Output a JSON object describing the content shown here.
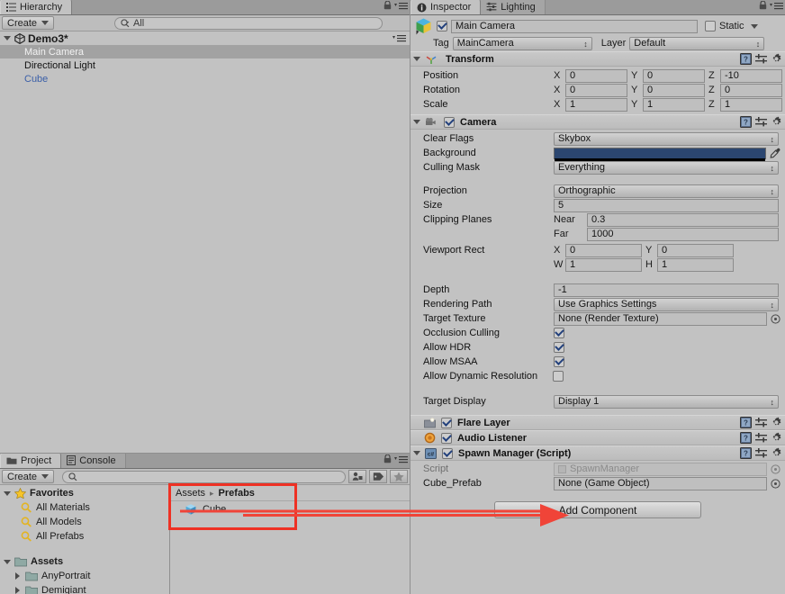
{
  "app": "unity-editor",
  "hierarchy": {
    "tabs": [
      {
        "label": "Hierarchy",
        "icon": "hierarchy-icon",
        "active": true
      }
    ],
    "create_label": "Create",
    "search_value": "All",
    "search_placeholder": "",
    "scene": {
      "name": "Demo3*",
      "icon": "unity-scene-icon"
    },
    "items": [
      {
        "label": "Main Camera",
        "selected": true,
        "prefab": false
      },
      {
        "label": "Directional Light",
        "selected": false,
        "prefab": false
      },
      {
        "label": "Cube",
        "selected": false,
        "prefab": true
      }
    ]
  },
  "project": {
    "tabs": [
      {
        "label": "Project",
        "icon": "folder-icon",
        "active": true
      },
      {
        "label": "Console",
        "icon": "console-icon",
        "active": false
      }
    ],
    "create_label": "Create",
    "search_value": "",
    "search_placeholder": "",
    "filter_icons": [
      "filter-by-type-icon",
      "filter-by-label-icon",
      "favorite-star-icon"
    ],
    "tree": [
      {
        "label": "Favorites",
        "icon": "star-icon",
        "depth": 0,
        "expanded": true,
        "bold": true
      },
      {
        "label": "All Materials",
        "icon": "search-icon",
        "depth": 1,
        "bold": false
      },
      {
        "label": "All Models",
        "icon": "search-icon",
        "depth": 1,
        "bold": false
      },
      {
        "label": "All Prefabs",
        "icon": "search-icon",
        "depth": 1,
        "bold": false
      },
      {
        "label": "Assets",
        "icon": "folder-icon",
        "depth": 0,
        "expanded": true,
        "bold": true
      },
      {
        "label": "AnyPortrait",
        "icon": "folder-icon",
        "depth": 1,
        "collapsed": true,
        "bold": false
      },
      {
        "label": "Demigiant",
        "icon": "folder-icon",
        "depth": 1,
        "collapsed": true,
        "bold": false
      }
    ],
    "breadcrumb": {
      "root": "Assets",
      "current": "Prefabs",
      "separator": "▸"
    },
    "assets": [
      {
        "label": "Cube",
        "icon": "prefab-cube-icon"
      }
    ]
  },
  "inspector": {
    "tabs": [
      {
        "label": "Inspector",
        "icon": "info-icon",
        "active": true
      },
      {
        "label": "Lighting",
        "icon": "lighting-icon",
        "active": false
      }
    ],
    "object": {
      "icon": "gameobject-cube-icon",
      "enabled": true,
      "name": "Main Camera",
      "static_label": "Static",
      "static_checked": false,
      "tag_label": "Tag",
      "tag_value": "MainCamera",
      "layer_label": "Layer",
      "layer_value": "Default"
    },
    "components": [
      {
        "name": "Transform",
        "icon": "transform-axis-icon",
        "expanded": true,
        "has_checkbox": false,
        "rows": [
          {
            "label": "Position",
            "type": "vector3",
            "x": "0",
            "y": "0",
            "z": "-10"
          },
          {
            "label": "Rotation",
            "type": "vector3",
            "x": "0",
            "y": "0",
            "z": "0"
          },
          {
            "label": "Scale",
            "type": "vector3",
            "x": "1",
            "y": "1",
            "z": "1"
          }
        ]
      },
      {
        "name": "Camera",
        "icon": "camera-icon",
        "expanded": true,
        "has_checkbox": true,
        "checked": true,
        "rows": [
          {
            "label": "Clear Flags",
            "type": "popup",
            "value": "Skybox"
          },
          {
            "label": "Background",
            "type": "color",
            "value": "#2b4670"
          },
          {
            "label": "Culling Mask",
            "type": "popup",
            "value": "Everything"
          },
          {
            "type": "spacer"
          },
          {
            "label": "Projection",
            "type": "popup",
            "value": "Orthographic"
          },
          {
            "label": "Size",
            "type": "text",
            "value": "5"
          },
          {
            "label": "Clipping Planes",
            "type": "pair",
            "a_label": "Near",
            "a_value": "0.3",
            "b_label": "Far",
            "b_value": "1000"
          },
          {
            "label": "Viewport Rect",
            "type": "rect",
            "x_label": "X",
            "x": "0",
            "y_label": "Y",
            "y": "0",
            "w_label": "W",
            "w": "1",
            "h_label": "H",
            "h": "1"
          },
          {
            "type": "spacer"
          },
          {
            "label": "Depth",
            "type": "text",
            "value": "-1"
          },
          {
            "label": "Rendering Path",
            "type": "popup",
            "value": "Use Graphics Settings"
          },
          {
            "label": "Target Texture",
            "type": "object",
            "value": "None (Render Texture)"
          },
          {
            "label": "Occlusion Culling",
            "type": "check",
            "checked": true
          },
          {
            "label": "Allow HDR",
            "type": "check",
            "checked": true
          },
          {
            "label": "Allow MSAA",
            "type": "check",
            "checked": true
          },
          {
            "label": "Allow Dynamic Resolution",
            "type": "check-wide",
            "checked": false
          },
          {
            "type": "spacer"
          },
          {
            "label": "Target Display",
            "type": "popup",
            "value": "Display 1"
          }
        ]
      },
      {
        "name": "Flare Layer",
        "icon": "flare-layer-icon",
        "expanded": false,
        "has_checkbox": true,
        "checked": true,
        "rows": []
      },
      {
        "name": "Audio Listener",
        "icon": "audio-listener-icon",
        "expanded": false,
        "has_checkbox": true,
        "checked": true,
        "rows": []
      },
      {
        "name": "Spawn Manager (Script)",
        "icon": "csharp-script-icon",
        "expanded": true,
        "has_checkbox": true,
        "checked": true,
        "rows": [
          {
            "label": "Script",
            "type": "object-readonly",
            "value": "SpawnManager"
          },
          {
            "label": "Cube_Prefab",
            "type": "object",
            "value": "None (Game Object)"
          }
        ]
      }
    ],
    "add_component_label": "Add Component"
  },
  "annotations": {
    "highlight_color": "#ee3124",
    "arrow_color": "#f04438"
  }
}
